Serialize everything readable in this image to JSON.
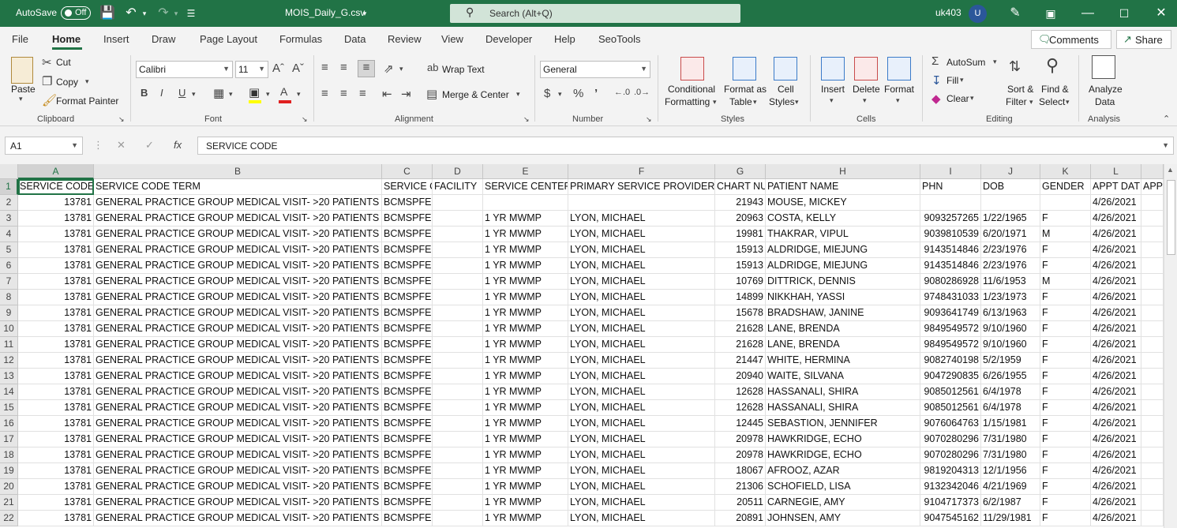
{
  "titlebar": {
    "autosave_label": "AutoSave",
    "autosave_state": "Off",
    "filename": "MOIS_Daily_G.csv",
    "search_placeholder": "Search (Alt+Q)",
    "user": "uk403",
    "avatar_initial": "U"
  },
  "menu": {
    "tabs": [
      "File",
      "Home",
      "Insert",
      "Draw",
      "Page Layout",
      "Formulas",
      "Data",
      "Review",
      "View",
      "Developer",
      "Help",
      "SeoTools"
    ],
    "active": "Home",
    "comments": "Comments",
    "share": "Share"
  },
  "ribbon": {
    "clipboard": {
      "paste": "Paste",
      "cut": "Cut",
      "copy": "Copy",
      "format_painter": "Format Painter",
      "label": "Clipboard"
    },
    "font": {
      "name": "Calibri",
      "size": "11",
      "label": "Font"
    },
    "alignment": {
      "wrap_text": "Wrap Text",
      "merge_center": "Merge & Center",
      "label": "Alignment"
    },
    "number": {
      "format": "General",
      "label": "Number"
    },
    "styles": {
      "conditional_1": "Conditional",
      "conditional_2": "Formatting",
      "format_table_1": "Format as",
      "format_table_2": "Table",
      "cell_styles_1": "Cell",
      "cell_styles_2": "Styles",
      "label": "Styles"
    },
    "cells": {
      "insert": "Insert",
      "delete": "Delete",
      "format": "Format",
      "label": "Cells"
    },
    "editing": {
      "autosum": "AutoSum",
      "fill": "Fill",
      "clear": "Clear",
      "sort_1": "Sort &",
      "sort_2": "Filter",
      "find_1": "Find &",
      "find_2": "Select",
      "label": "Editing"
    },
    "analysis": {
      "analyze_1": "Analyze",
      "analyze_2": "Data",
      "label": "Analysis"
    }
  },
  "formula_bar": {
    "name_box": "A1",
    "formula": "SERVICE CODE"
  },
  "sheet": {
    "columns": [
      "A",
      "B",
      "C",
      "D",
      "E",
      "F",
      "G",
      "H",
      "I",
      "J",
      "K",
      "L"
    ],
    "headers": [
      "SERVICE CODE",
      "SERVICE CODE TERM",
      "SERVICE C",
      "FACILITY",
      "SERVICE CENTER",
      "PRIMARY SERVICE PROVIDER",
      "CHART NU",
      "PATIENT NAME",
      "PHN",
      "DOB",
      "GENDER",
      "APPT DAT",
      "APP"
    ],
    "rows": [
      [
        "13781",
        "GENERAL PRACTICE GROUP MEDICAL VISIT- >20 PATIENTS",
        "BCMSPFEE",
        "",
        "",
        "",
        "21943",
        "MOUSE, MICKEY",
        "",
        "",
        "",
        "4/26/2021"
      ],
      [
        "13781",
        "GENERAL PRACTICE GROUP MEDICAL VISIT- >20 PATIENTS",
        "BCMSPFEE",
        "",
        "1 YR MWMP",
        "LYON, MICHAEL",
        "20963",
        "COSTA, KELLY",
        "9093257265",
        "1/22/1965",
        "F",
        "4/26/2021"
      ],
      [
        "13781",
        "GENERAL PRACTICE GROUP MEDICAL VISIT- >20 PATIENTS",
        "BCMSPFEE",
        "",
        "1 YR MWMP",
        "LYON, MICHAEL",
        "19981",
        "THAKRAR, VIPUL",
        "9039810539",
        "6/20/1971",
        "M",
        "4/26/2021"
      ],
      [
        "13781",
        "GENERAL PRACTICE GROUP MEDICAL VISIT- >20 PATIENTS",
        "BCMSPFEE",
        "",
        "1 YR MWMP",
        "LYON, MICHAEL",
        "15913",
        "ALDRIDGE, MIEJUNG",
        "9143514846",
        "2/23/1976",
        "F",
        "4/26/2021"
      ],
      [
        "13781",
        "GENERAL PRACTICE GROUP MEDICAL VISIT- >20 PATIENTS",
        "BCMSPFEE",
        "",
        "1 YR MWMP",
        "LYON, MICHAEL",
        "15913",
        "ALDRIDGE, MIEJUNG",
        "9143514846",
        "2/23/1976",
        "F",
        "4/26/2021"
      ],
      [
        "13781",
        "GENERAL PRACTICE GROUP MEDICAL VISIT- >20 PATIENTS",
        "BCMSPFEE",
        "",
        "1 YR MWMP",
        "LYON, MICHAEL",
        "10769",
        "DITTRICK, DENNIS",
        "9080286928",
        "11/6/1953",
        "M",
        "4/26/2021"
      ],
      [
        "13781",
        "GENERAL PRACTICE GROUP MEDICAL VISIT- >20 PATIENTS",
        "BCMSPFEE",
        "",
        "1 YR MWMP",
        "LYON, MICHAEL",
        "14899",
        "NIKKHAH, YASSI",
        "9748431033",
        "1/23/1973",
        "F",
        "4/26/2021"
      ],
      [
        "13781",
        "GENERAL PRACTICE GROUP MEDICAL VISIT- >20 PATIENTS",
        "BCMSPFEE",
        "",
        "1 YR MWMP",
        "LYON, MICHAEL",
        "15678",
        "BRADSHAW, JANINE",
        "9093641749",
        "6/13/1963",
        "F",
        "4/26/2021"
      ],
      [
        "13781",
        "GENERAL PRACTICE GROUP MEDICAL VISIT- >20 PATIENTS",
        "BCMSPFEE",
        "",
        "1 YR MWMP",
        "LYON, MICHAEL",
        "21628",
        "LANE, BRENDA",
        "9849549572",
        "9/10/1960",
        "F",
        "4/26/2021"
      ],
      [
        "13781",
        "GENERAL PRACTICE GROUP MEDICAL VISIT- >20 PATIENTS",
        "BCMSPFEE",
        "",
        "1 YR MWMP",
        "LYON, MICHAEL",
        "21628",
        "LANE, BRENDA",
        "9849549572",
        "9/10/1960",
        "F",
        "4/26/2021"
      ],
      [
        "13781",
        "GENERAL PRACTICE GROUP MEDICAL VISIT- >20 PATIENTS",
        "BCMSPFEE",
        "",
        "1 YR MWMP",
        "LYON, MICHAEL",
        "21447",
        "WHITE, HERMINA",
        "9082740198",
        "5/2/1959",
        "F",
        "4/26/2021"
      ],
      [
        "13781",
        "GENERAL PRACTICE GROUP MEDICAL VISIT- >20 PATIENTS",
        "BCMSPFEE",
        "",
        "1 YR MWMP",
        "LYON, MICHAEL",
        "20940",
        "WAITE, SILVANA",
        "9047290835",
        "6/26/1955",
        "F",
        "4/26/2021"
      ],
      [
        "13781",
        "GENERAL PRACTICE GROUP MEDICAL VISIT- >20 PATIENTS",
        "BCMSPFEE",
        "",
        "1 YR MWMP",
        "LYON, MICHAEL",
        "12628",
        "HASSANALI, SHIRA",
        "9085012561",
        "6/4/1978",
        "F",
        "4/26/2021"
      ],
      [
        "13781",
        "GENERAL PRACTICE GROUP MEDICAL VISIT- >20 PATIENTS",
        "BCMSPFEE",
        "",
        "1 YR MWMP",
        "LYON, MICHAEL",
        "12628",
        "HASSANALI, SHIRA",
        "9085012561",
        "6/4/1978",
        "F",
        "4/26/2021"
      ],
      [
        "13781",
        "GENERAL PRACTICE GROUP MEDICAL VISIT- >20 PATIENTS",
        "BCMSPFEE",
        "",
        "1 YR MWMP",
        "LYON, MICHAEL",
        "12445",
        "SEBASTION, JENNIFER",
        "9076064763",
        "1/15/1981",
        "F",
        "4/26/2021"
      ],
      [
        "13781",
        "GENERAL PRACTICE GROUP MEDICAL VISIT- >20 PATIENTS",
        "BCMSPFEE",
        "",
        "1 YR MWMP",
        "LYON, MICHAEL",
        "20978",
        "HAWKRIDGE, ECHO",
        "9070280296",
        "7/31/1980",
        "F",
        "4/26/2021"
      ],
      [
        "13781",
        "GENERAL PRACTICE GROUP MEDICAL VISIT- >20 PATIENTS",
        "BCMSPFEE",
        "",
        "1 YR MWMP",
        "LYON, MICHAEL",
        "20978",
        "HAWKRIDGE, ECHO",
        "9070280296",
        "7/31/1980",
        "F",
        "4/26/2021"
      ],
      [
        "13781",
        "GENERAL PRACTICE GROUP MEDICAL VISIT- >20 PATIENTS",
        "BCMSPFEE",
        "",
        "1 YR MWMP",
        "LYON, MICHAEL",
        "18067",
        "AFROOZ, AZAR",
        "9819204313",
        "12/1/1956",
        "F",
        "4/26/2021"
      ],
      [
        "13781",
        "GENERAL PRACTICE GROUP MEDICAL VISIT- >20 PATIENTS",
        "BCMSPFEE",
        "",
        "1 YR MWMP",
        "LYON, MICHAEL",
        "21306",
        "SCHOFIELD, LISA",
        "9132342046",
        "4/21/1969",
        "F",
        "4/26/2021"
      ],
      [
        "13781",
        "GENERAL PRACTICE GROUP MEDICAL VISIT- >20 PATIENTS",
        "BCMSPFEE",
        "",
        "1 YR MWMP",
        "LYON, MICHAEL",
        "20511",
        "CARNEGIE, AMY",
        "9104717373",
        "6/2/1987",
        "F",
        "4/26/2021"
      ],
      [
        "13781",
        "GENERAL PRACTICE GROUP MEDICAL VISIT- >20 PATIENTS",
        "BCMSPFEE",
        "",
        "1 YR MWMP",
        "LYON, MICHAEL",
        "20891",
        "JOHNSEN, AMY",
        "9047545162",
        "11/29/1981",
        "F",
        "4/26/2021"
      ]
    ]
  }
}
